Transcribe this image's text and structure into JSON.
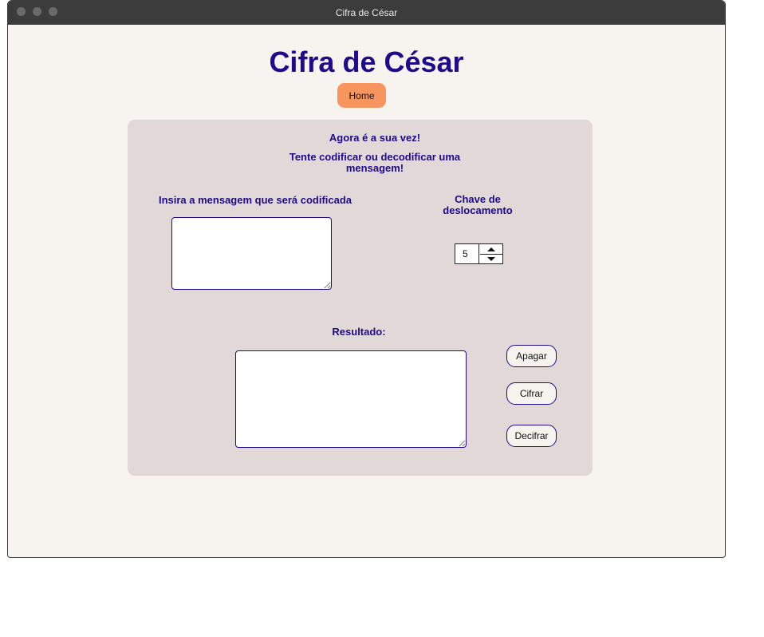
{
  "window": {
    "title": "Cifra de César"
  },
  "header": {
    "title": "Cifra de César",
    "home_label": "Home"
  },
  "card": {
    "intro_line1": "Agora é a sua vez!",
    "intro_line2": "Tente codificar ou decodificar uma mensagem!",
    "message_label": "Insira a mensagem que será codificada",
    "message_value": "",
    "key_label": "Chave de deslocamento",
    "key_value": "5",
    "result_label": "Resultado:",
    "result_value": "",
    "buttons": {
      "clear": "Apagar",
      "encrypt": "Cifrar",
      "decrypt": "Decifrar"
    }
  },
  "colors": {
    "accent": "#1e0a8c",
    "home_button": "#f7955e",
    "card_bg": "#e2d8d8",
    "page_bg": "#f7f4f0"
  }
}
